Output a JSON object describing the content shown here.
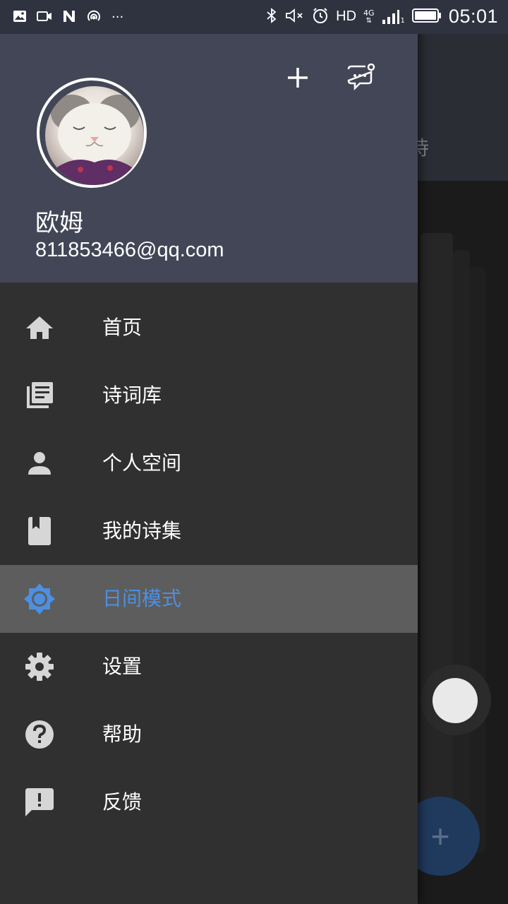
{
  "status_bar": {
    "left_icons": [
      "image-icon",
      "video-icon",
      "n-icon",
      "hotspot-icon",
      "more-dots-icon"
    ],
    "right_icons": [
      "bluetooth-icon",
      "mute-icon",
      "alarm-icon",
      "network-4g-icon",
      "signal-icon",
      "battery-icon"
    ],
    "network_label": "HD",
    "network_type": "4G",
    "sim_slot": "1",
    "time": "05:01"
  },
  "background_app": {
    "tab_label_partial": "诗",
    "fab_label": "+"
  },
  "drawer": {
    "header": {
      "user_name": "欧姆",
      "user_email": "811853466@qq.com",
      "add_icon": "plus-icon",
      "message_icon": "chat-bubble-icon"
    },
    "menu_items": [
      {
        "label": "首页",
        "icon": "home-icon",
        "active": false
      },
      {
        "label": "诗词库",
        "icon": "library-icon",
        "active": false
      },
      {
        "label": "个人空间",
        "icon": "person-icon",
        "active": false
      },
      {
        "label": "我的诗集",
        "icon": "bookmark-book-icon",
        "active": false
      },
      {
        "label": "日间模式",
        "icon": "brightness-icon",
        "active": true
      },
      {
        "label": "设置",
        "icon": "settings-gear-icon",
        "active": false
      },
      {
        "label": "帮助",
        "icon": "help-icon",
        "active": false
      },
      {
        "label": "反馈",
        "icon": "feedback-icon",
        "active": false
      }
    ]
  },
  "colors": {
    "status_bar": "#2f3340",
    "drawer_header": "#424656",
    "drawer_body": "#303030",
    "active_item_bg": "#5d5d5d",
    "accent_blue": "#4d8fe0",
    "icon_gray": "#d6d6d6"
  }
}
